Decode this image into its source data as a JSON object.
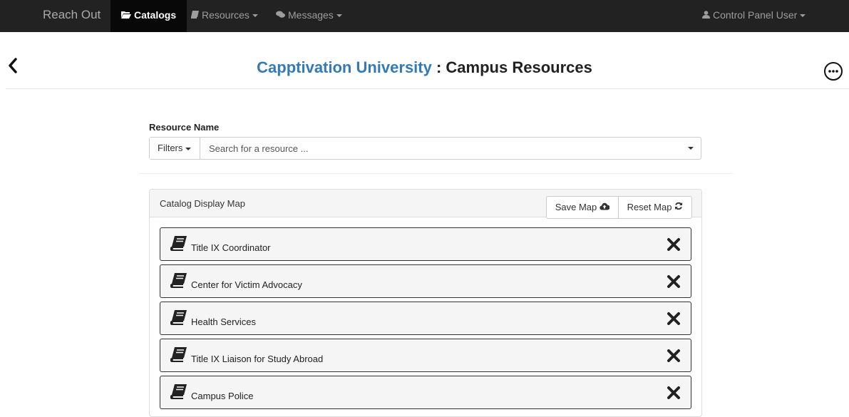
{
  "navbar": {
    "brand": "Reach Out",
    "items": [
      {
        "label": "Catalogs",
        "icon": "folder-open-icon",
        "active": true
      },
      {
        "label": "Resources",
        "icon": "book-icon",
        "dropdown": true
      },
      {
        "label": "Messages",
        "icon": "comments-icon",
        "dropdown": true
      }
    ],
    "user": {
      "label": "Control Panel User",
      "icon": "user-icon"
    }
  },
  "header": {
    "university": "Capptivation University",
    "separator": " : ",
    "title": "Campus Resources"
  },
  "search": {
    "label": "Resource Name",
    "filters_label": "Filters",
    "placeholder": "Search for a resource ..."
  },
  "panel": {
    "title": "Catalog Display Map",
    "save_label": "Save Map",
    "reset_label": "Reset Map"
  },
  "resources": [
    {
      "label": "Title IX Coordinator"
    },
    {
      "label": "Center for Victim Advocacy"
    },
    {
      "label": "Health Services"
    },
    {
      "label": "Title IX Liaison for Study Abroad"
    },
    {
      "label": "Campus Police"
    }
  ],
  "colors": {
    "navbar": "#222222",
    "accent": "#337ab7"
  }
}
